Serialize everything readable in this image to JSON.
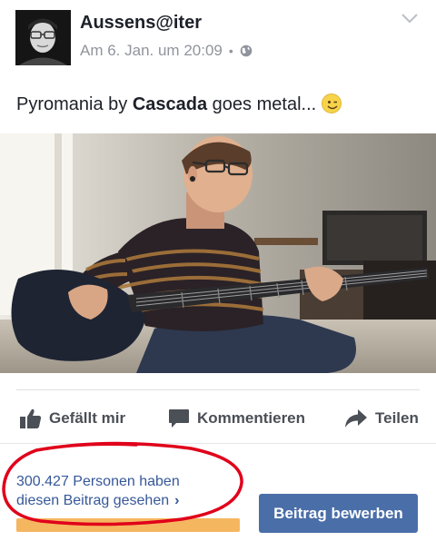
{
  "post": {
    "author": "Aussens@iter",
    "timestamp": "Am 6. Jan. um 20:09",
    "separator": "•",
    "privacy_icon": "globe-icon",
    "text_before": "Pyromania by ",
    "text_bold": "Cascada",
    "text_after": " goes metal...",
    "emoji": "winking-face-icon"
  },
  "actions": {
    "like": "Gefällt mir",
    "comment": "Kommentieren",
    "share": "Teilen"
  },
  "insights": {
    "seen_line1": "300.427 Personen haben",
    "seen_line2": "diesen Beitrag gesehen",
    "boost_button": "Beitrag bewerben"
  },
  "colors": {
    "link": "#365899",
    "boost_bg": "#4a6ea8",
    "progress": "#f5b660",
    "annotation_circle": "#e0001a"
  }
}
